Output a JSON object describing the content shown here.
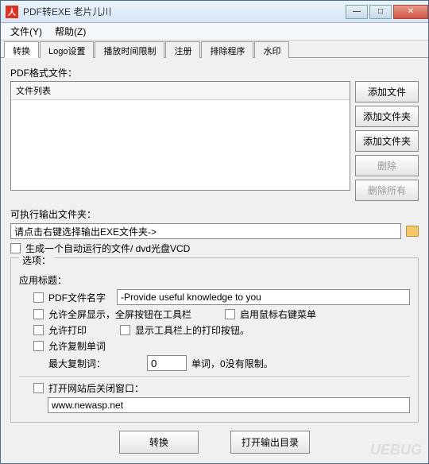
{
  "titlebar": {
    "icon_glyph": "人",
    "text": "PDF转EXE   老片儿川"
  },
  "menu": {
    "file": "文件(Y)",
    "help": "帮助(Z)"
  },
  "tabs": [
    "转换",
    "Logo设置",
    "播放时间限制",
    "注册",
    "排除程序",
    "水印"
  ],
  "labels": {
    "pdf_files": "PDF格式文件：",
    "file_list_header": "文件列表",
    "output_folder": "可执行输出文件夹：",
    "output_path": "请点击右键选择输出EXE文件夹->",
    "autorun": "生成一个自动运行的文件/ dvd光盘VCD",
    "options_legend": "选项：",
    "app_title": "应用标题：",
    "pdf_filename": "PDF文件名字",
    "title_value": "-Provide useful knowledge to you",
    "fullscreen": "允许全屏显示，全屏按钮在工具栏",
    "rightclick": "启用鼠标右键菜单",
    "allow_print": "允许打印",
    "show_print_btn": "显示工具栏上的打印按钮。",
    "allow_copy": "允许复制单词",
    "max_copy": "最大复制词：",
    "max_copy_val": "0",
    "max_copy_suffix": "单词，0没有限制。",
    "close_after_open": "打开网站后关闭窗口：",
    "url": "www.newasp.net"
  },
  "buttons": {
    "add_file": "添加文件",
    "add_folder1": "添加文件夹",
    "add_folder2": "添加文件夹",
    "delete": "删除",
    "delete_all": "删除所有",
    "convert": "转换",
    "open_output": "打开输出目录"
  },
  "watermark": "UEBUG"
}
